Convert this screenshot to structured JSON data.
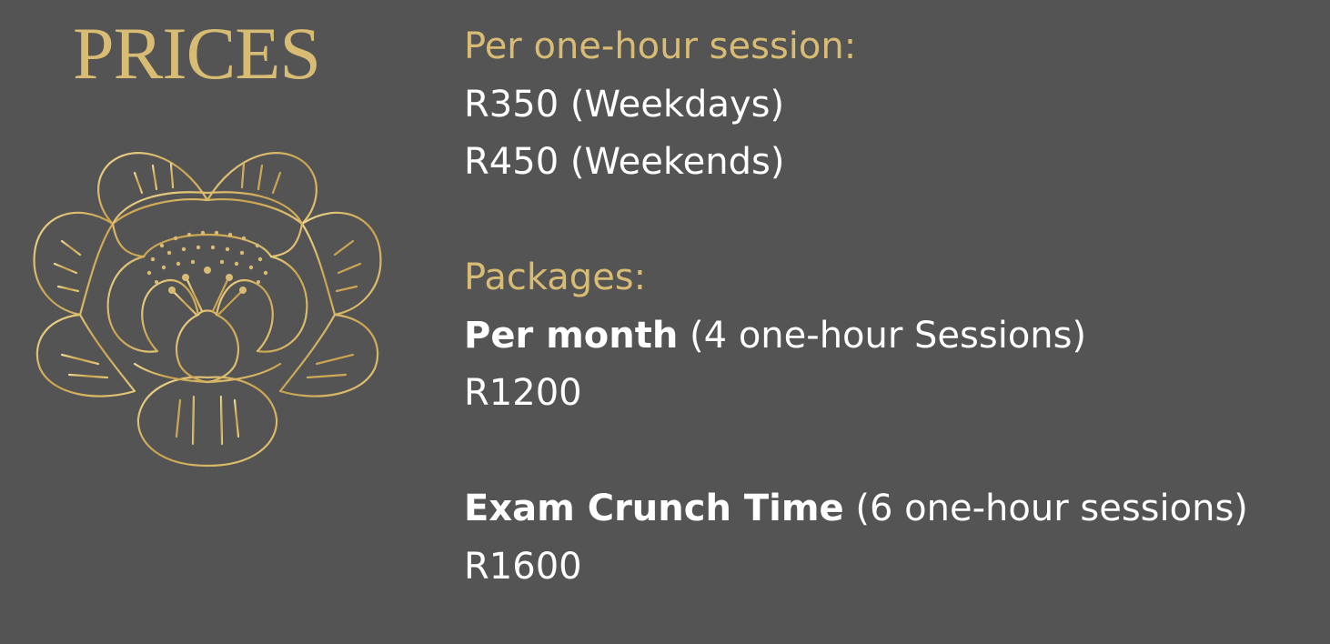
{
  "title": "PRICES",
  "colors": {
    "background": "#545454",
    "accent_gold": "#d9bc74",
    "text_white": "#ffffff"
  },
  "decor_icon": "flower-icon",
  "session": {
    "heading": "Per one-hour session:",
    "weekdays": "R350 (Weekdays)",
    "weekends": "R450 (Weekends)"
  },
  "packages": {
    "heading": "Packages:",
    "monthly": {
      "name": "Per month",
      "detail": " (4 one-hour Sessions)",
      "price": "R1200"
    },
    "exam": {
      "name": "Exam Crunch Time",
      "detail": " (6 one-hour sessions)",
      "price": "R1600"
    }
  }
}
